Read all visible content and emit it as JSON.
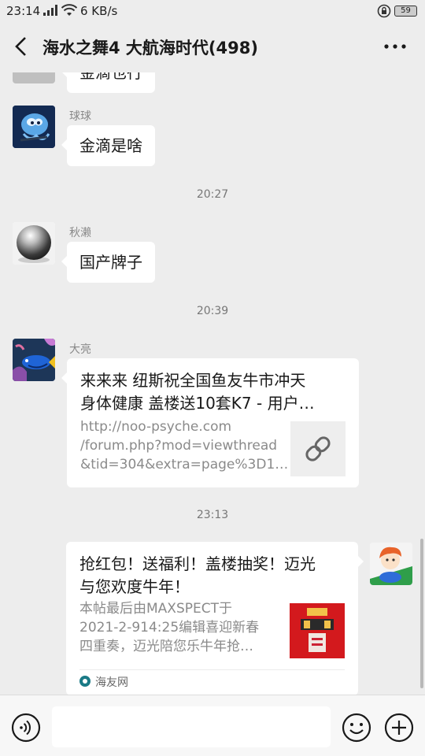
{
  "status_bar": {
    "time": "23:14",
    "network_speed": "6 KB/s",
    "battery_level": "59"
  },
  "header": {
    "title": "海水之舞4 大航海时代(498)"
  },
  "messages": {
    "partial_top": {
      "text": "金滴也行"
    },
    "m1": {
      "sender": "球球",
      "text": "金滴是啥"
    },
    "ts1": "20:27",
    "m2": {
      "sender": "秋濑",
      "text": "国产牌子"
    },
    "ts2": "20:39",
    "m3": {
      "sender": "大亮",
      "title_line1": "来来来 纽斯祝全国鱼友牛市冲天",
      "title_line2": "身体健康 盖楼送10套K7 - 用户…",
      "desc_line1": "http://noo-psyche.com",
      "desc_line2": "/forum.php?mod=viewthread",
      "desc_line3": "&tid=304&extra=page%3D1…"
    },
    "ts3": "23:13",
    "m4": {
      "title_line1": "抢红包！送福利！盖楼抽奖！迈光",
      "title_line2": "与您欢度牛年！",
      "desc_line1": "本帖最后由MAXSPECT于",
      "desc_line2": "2021-2-914:25编辑喜迎新春",
      "desc_line3": "四重奏，迈光陪您乐牛年抢…",
      "source": "海友网"
    }
  },
  "colors": {
    "background": "#ededed",
    "bubble": "#ffffff",
    "meta_text": "#888888"
  },
  "icons": [
    "back-icon",
    "more-icon",
    "link-icon",
    "voice-icon",
    "emoji-icon",
    "plus-icon",
    "signal-icon",
    "wifi-icon",
    "alarm-icon"
  ]
}
